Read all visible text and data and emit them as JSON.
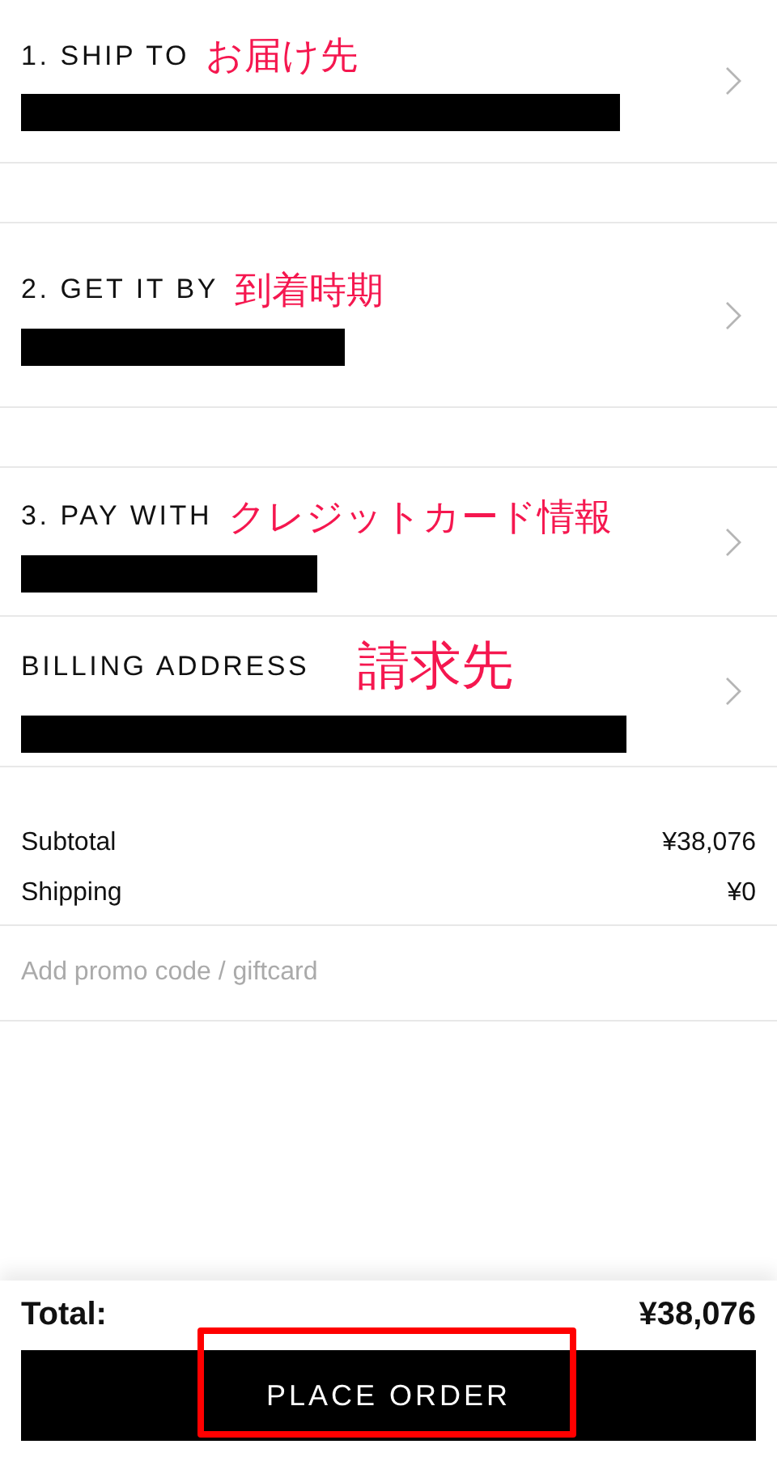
{
  "sections": [
    {
      "kind": "step",
      "label": "1. SHIP TO",
      "annotation": "お届け先"
    },
    {
      "kind": "spacer"
    },
    {
      "kind": "step",
      "label": "2. GET IT BY",
      "annotation": "到着時期"
    },
    {
      "kind": "spacer"
    },
    {
      "kind": "step",
      "label": "3. PAY WITH",
      "annotation": "クレジットカード情報"
    },
    {
      "kind": "step",
      "label": "BILLING ADDRESS",
      "annotation": "請求先"
    }
  ],
  "summary": [
    {
      "label": "Subtotal",
      "value": "¥38,076"
    },
    {
      "label": "Shipping",
      "value": "¥0"
    }
  ],
  "promo": {
    "placeholder": "Add promo code / giftcard"
  },
  "total": {
    "label": "Total:",
    "value": "¥38,076"
  },
  "button": {
    "label": "PLACE ORDER",
    "highlighted": true
  }
}
